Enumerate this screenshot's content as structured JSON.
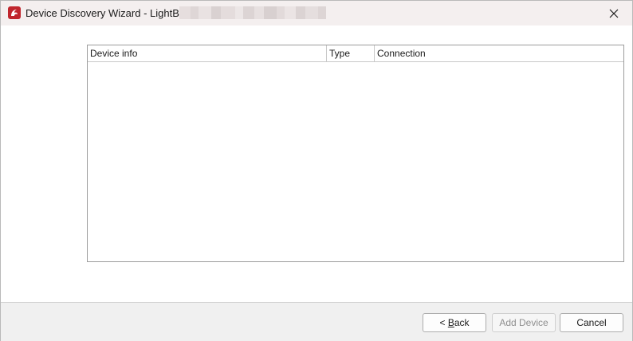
{
  "window": {
    "title": "Device Discovery Wizard - LightBurn",
    "icon": "lightburn-app-icon",
    "close_icon": "close-icon",
    "brand_color": "#c0262d"
  },
  "table": {
    "columns": [
      "Device info",
      "Type",
      "Connection"
    ],
    "rows": []
  },
  "footer": {
    "back": {
      "prefix": "< ",
      "mnemonic": "B",
      "rest": "ack",
      "enabled": true
    },
    "add_device": {
      "label": "Add Device",
      "enabled": false
    },
    "cancel": {
      "label": "Cancel",
      "enabled": true
    }
  }
}
